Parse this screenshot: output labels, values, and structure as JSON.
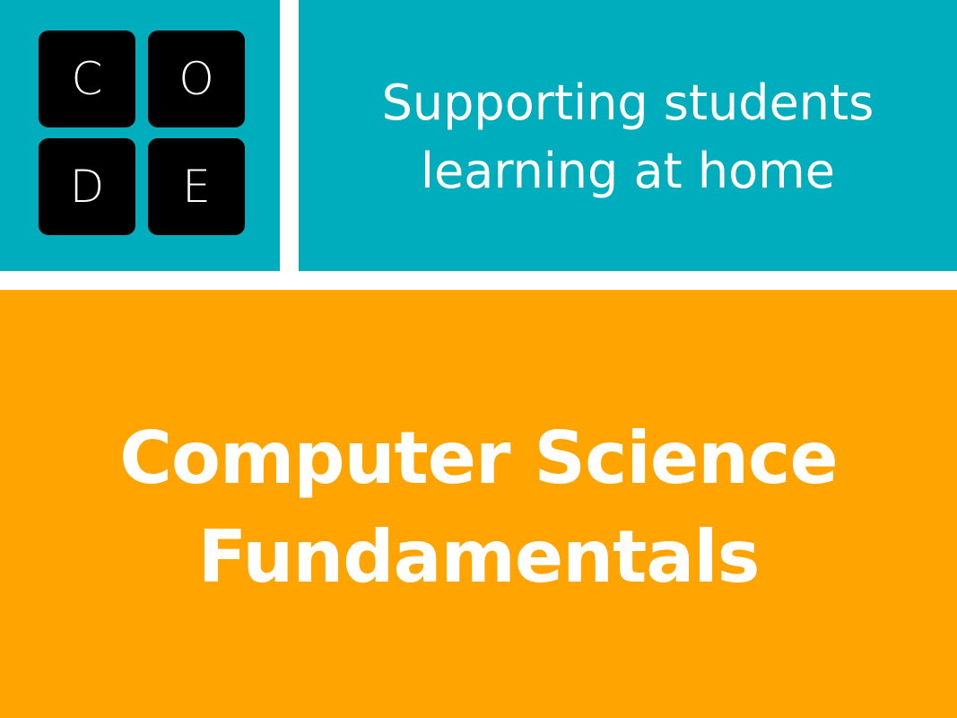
{
  "logo": {
    "letters": [
      "C",
      "O",
      "D",
      "E"
    ]
  },
  "tagline": {
    "lines": [
      "Supporting students",
      "learning at home"
    ]
  },
  "title": {
    "lines": [
      "Computer Science",
      "Fundamentals"
    ]
  },
  "colors": {
    "teal": "#00adbc",
    "orange": "#ffa400",
    "tile": "#000000",
    "text": "#ffffff",
    "divider": "#ffffff"
  }
}
